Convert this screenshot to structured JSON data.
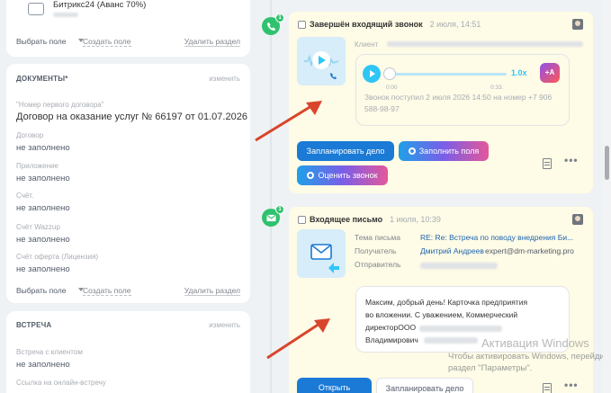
{
  "left": {
    "top_card": {
      "value": "Битрикс24 (Аванс 70%)",
      "footer": {
        "select": "Выбрать поле",
        "create": "Создать поле",
        "delete": "Удалить раздел"
      }
    },
    "documents": {
      "title": "ДОКУМЕНТЫ*",
      "edit": "изменить",
      "fields": [
        {
          "label": "\"Номер первого договора\"",
          "value": "Договор на оказание услуг № 66197 от 01.07.2026"
        },
        {
          "label": "Договор",
          "value": "не заполнено"
        },
        {
          "label": "Приложение",
          "value": "не заполнено"
        },
        {
          "label": "Счёт.",
          "value": "не заполнено"
        },
        {
          "label": "Счёт Wazzup",
          "value": "не заполнено"
        },
        {
          "label": "Счёт оферта (Лицензия)",
          "value": "не заполнено"
        }
      ],
      "footer": {
        "select": "Выбрать поле",
        "create": "Создать поле",
        "delete": "Удалить раздел"
      }
    },
    "meeting": {
      "title": "ВСТРЕЧА",
      "edit": "изменить",
      "fields": [
        {
          "label": "Встреча с клиентом",
          "value": "не заполнено"
        },
        {
          "label": "Ссылка на онлайн-встречу",
          "value": ""
        }
      ]
    }
  },
  "timeline": {
    "call": {
      "badge": "1",
      "title": "Завершён входящий звонок",
      "date": "2 июля, 14:51",
      "client_label": "Клиент",
      "speed": "1.0x",
      "ai_label": "+A",
      "time_start": "0:00",
      "time_end": "0:33.",
      "record_text": "Звонок поступил 2 июля 2026 14:50 на номер +7 906 588-98-97",
      "buttons": {
        "schedule": "Запланировать дело",
        "fill": "Заполнить поля",
        "rate": "Оценить звонок"
      }
    },
    "email": {
      "badge": "1",
      "title": "Входящее письмо",
      "date": "1 июля, 10:39",
      "fields": {
        "subject_label": "Тема письма",
        "subject": "RE: Re: Встреча по поводу внедрения Би...",
        "recipient_label": "Получатель",
        "recipient_name": "Дмитрий Андреев",
        "recipient_email": "expert@dm-marketing.pro",
        "sender_label": "Отправитель"
      },
      "body_lines": [
        "Максим, добрый день! Карточка предприятия",
        "во вложении. С уважением, Коммерческий",
        "директорООО",
        "Владимирович"
      ],
      "buttons": {
        "open": "Открыть",
        "schedule": "Запланировать дело"
      }
    }
  },
  "watermark": {
    "title": "Активация Windows",
    "line1": "Чтобы активировать Windows, перейди",
    "line2": "раздел \"Параметры\"."
  },
  "colors": {
    "accent": "#2fc6f6",
    "primary": "#1a7ad6",
    "success": "#2fc26e",
    "item_bg": "#fefbe6",
    "arrow": "#d9452b"
  }
}
